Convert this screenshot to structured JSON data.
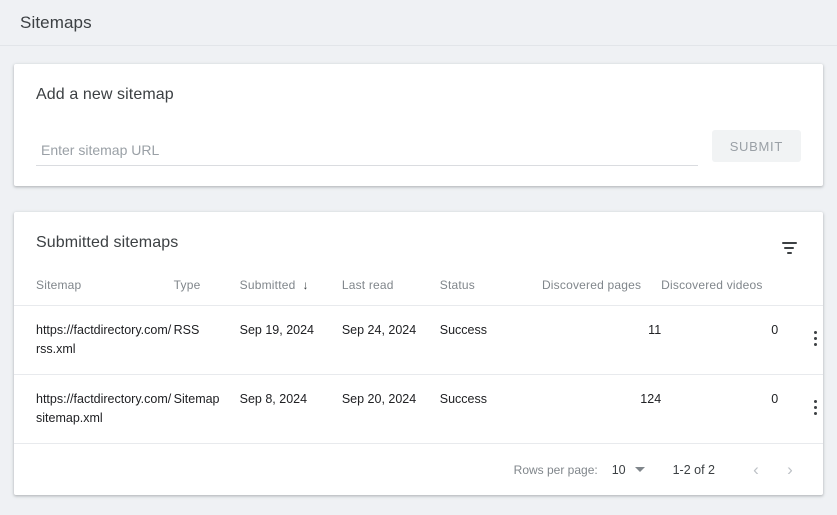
{
  "header": {
    "title": "Sitemaps"
  },
  "add_sitemap": {
    "heading": "Add a new sitemap",
    "input_value": "",
    "input_placeholder": "Enter sitemap URL",
    "submit_label": "SUBMIT"
  },
  "submitted": {
    "heading": "Submitted sitemaps",
    "filter_icon": "filter-icon",
    "columns": [
      {
        "label": "Sitemap",
        "sorted": false
      },
      {
        "label": "Type",
        "sorted": false
      },
      {
        "label": "Submitted",
        "sorted": true,
        "sort_arrow": "↓"
      },
      {
        "label": "Last read",
        "sorted": false
      },
      {
        "label": "Status",
        "sorted": false
      },
      {
        "label": "Discovered pages",
        "sorted": false
      },
      {
        "label": "Discovered videos",
        "sorted": false
      }
    ],
    "rows": [
      {
        "sitemap": "https://factdirectory.com/rss.xml",
        "type": "RSS",
        "submitted": "Sep 19, 2024",
        "last_read": "Sep 24, 2024",
        "status": "Success",
        "discovered_pages": "11",
        "discovered_videos": "0",
        "menu_icon": "more-vert-icon"
      },
      {
        "sitemap": "https://factdirectory.com/sitemap.xml",
        "type": "Sitemap",
        "submitted": "Sep 8, 2024",
        "last_read": "Sep 20, 2024",
        "status": "Success",
        "discovered_pages": "124",
        "discovered_videos": "0",
        "menu_icon": "more-vert-icon"
      }
    ],
    "pagination": {
      "rows_per_page_label": "Rows per page:",
      "rows_per_page_value": "10",
      "range_label": "1-2 of 2",
      "prev_icon": "‹",
      "next_icon": "›"
    }
  },
  "colors": {
    "background": "#eff1f4",
    "card": "#ffffff",
    "status_success": "#188038",
    "text_primary": "#202124",
    "text_secondary": "#80868b"
  }
}
